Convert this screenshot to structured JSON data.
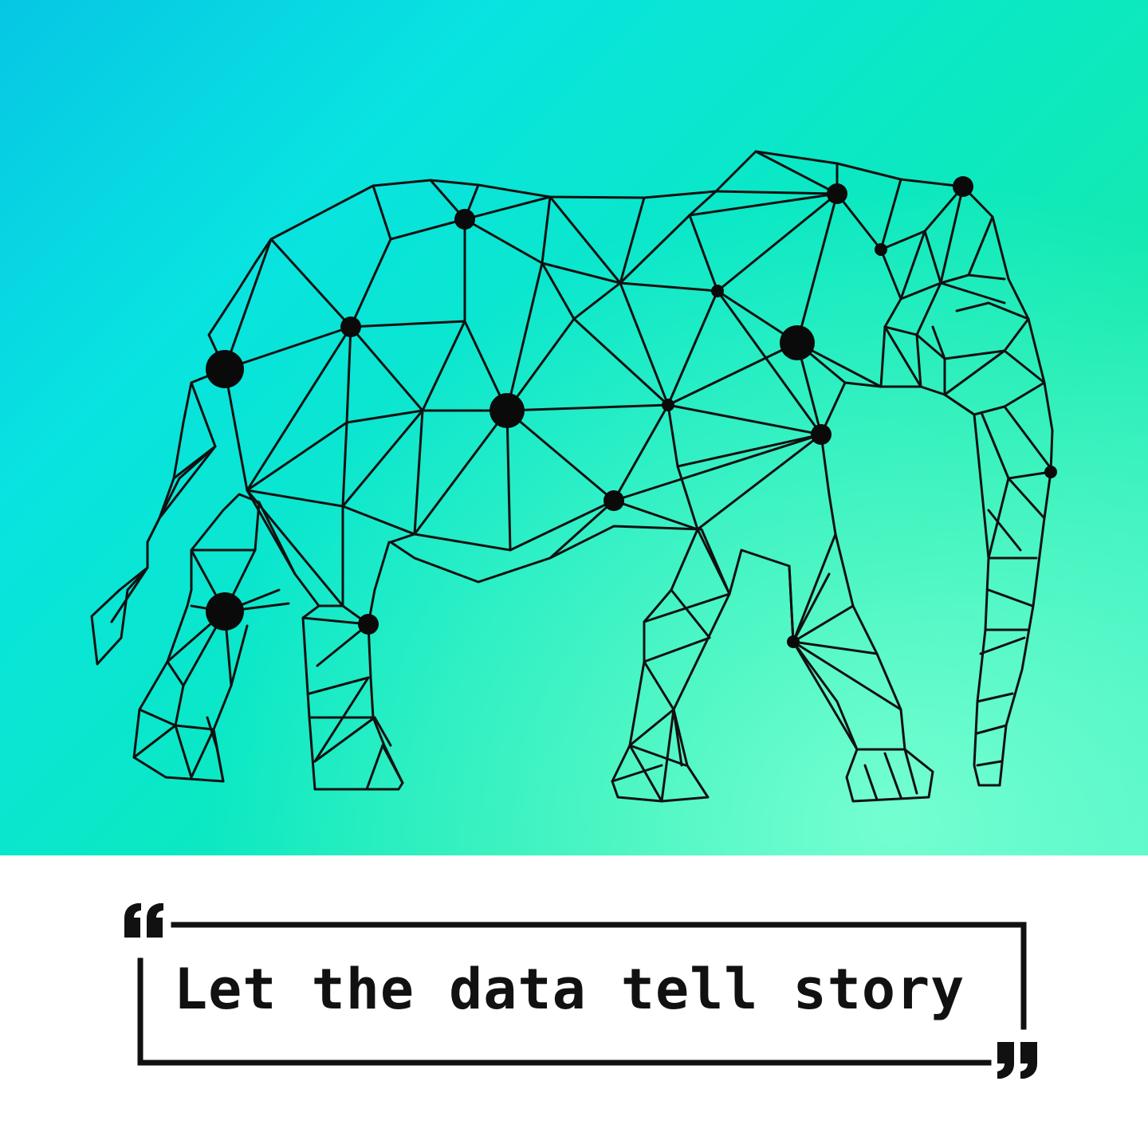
{
  "quote": {
    "text": "Let the data tell story",
    "open_mark_icon": "open-quote-icon",
    "close_mark_icon": "close-quote-icon"
  },
  "illustration": {
    "icon": "polygonal-elephant-network-icon"
  },
  "colors": {
    "background_top_left": "#06c6e4",
    "background_bottom_right": "#3cf1c4",
    "line": "#111111",
    "node": "#0a0a0a",
    "frame": "#111111"
  }
}
